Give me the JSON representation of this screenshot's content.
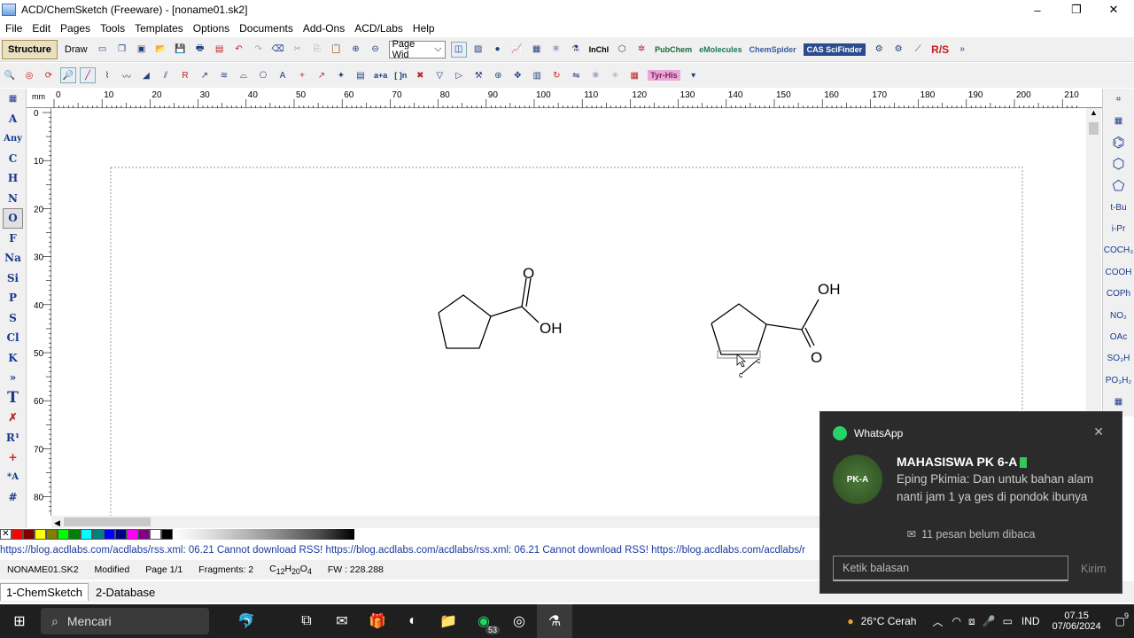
{
  "window": {
    "title": "ACD/ChemSketch (Freeware) - [noname01.sk2]",
    "min": "–",
    "max": "❐",
    "close": "✕"
  },
  "menu": [
    "File",
    "Edit",
    "Pages",
    "Tools",
    "Templates",
    "Options",
    "Documents",
    "Add-Ons",
    "ACD/Labs",
    "Help"
  ],
  "toolbar": {
    "structure_label": "Structure",
    "draw_label": "Draw",
    "zoom_select": "Page Wid",
    "inchi": "InChI",
    "pubchem": "PubChem",
    "emolecules": "eMolecules",
    "chemspider": "ChemSpider",
    "scifinder": "CAS SciFinder",
    "rs": "R/S",
    "tyr_his": "Tyr-His",
    "a_plus_a": "a+a",
    "bracket_n": "[ ]n"
  },
  "left_atoms": [
    "A",
    "Any",
    "C",
    "H",
    "N",
    "O",
    "F",
    "Na",
    "Si",
    "P",
    "S",
    "Cl",
    "K",
    "»",
    "T",
    "✗",
    "R¹",
    "+",
    "*A",
    "#"
  ],
  "right_groups": [
    "",
    "",
    "",
    "",
    "",
    "t-Bu",
    "i-Pr",
    "COCH₃",
    "COOH",
    "COPh",
    "NO₂",
    "OAc",
    "SO₃H",
    "PO₃H₂"
  ],
  "ruler": {
    "unit": "mm",
    "top_ticks": [
      "0",
      "10",
      "20",
      "30",
      "40",
      "50",
      "60",
      "70",
      "80",
      "90",
      "100",
      "110",
      "120",
      "130",
      "140",
      "150",
      "160",
      "170",
      "180",
      "190",
      "200",
      "210"
    ],
    "left_ticks": [
      "0",
      "10",
      "20",
      "30",
      "40",
      "50",
      "60",
      "70",
      "80"
    ]
  },
  "molecules": {
    "m1_o": "O",
    "m1_oh": "OH",
    "m2_o": "O",
    "m2_oh": "OH",
    "tip_c1": "c",
    "tip_c2": "c"
  },
  "palette": [
    "#ff0000",
    "#800000",
    "#ffff00",
    "#808000",
    "#00ff00",
    "#008000",
    "#00ffff",
    "#008080",
    "#0000ff",
    "#000080",
    "#ff00ff",
    "#800080",
    "#ffffff",
    "#000000"
  ],
  "rss_text": "https://blog.acdlabs.com/acdlabs/rss.xml: 06.21 Cannot download RSS!  https://blog.acdlabs.com/acdlabs/rss.xml: 06.21 Cannot download RSS!  https://blog.acdlabs.com/acdlabs/r",
  "status": {
    "file": "NONAME01.SK2",
    "state": "Modified",
    "page": "Page 1/1",
    "fragments": "Fragments: 2",
    "formula": "C12H20O4",
    "fw": "FW : 228.288"
  },
  "doc_tabs": [
    "1-ChemSketch",
    "2-Database"
  ],
  "taskbar": {
    "search": "Mencari",
    "whatsapp_badge": "53",
    "weather": "26°C  Cerah",
    "lang": "IND",
    "time": "07.15",
    "date": "07/06/2024",
    "notif_count": "9"
  },
  "notification": {
    "app": "WhatsApp",
    "from": "MAHASISWA PK 6-A",
    "avatar_text": "PK-A",
    "message": "Eping Pkimia: Dan untuk bahan alam nanti jam 1 ya ges di pondok ibunya",
    "unread": "11 pesan belum dibaca",
    "reply_placeholder": "Ketik balasan",
    "send": "Kirim",
    "close": "✕"
  }
}
